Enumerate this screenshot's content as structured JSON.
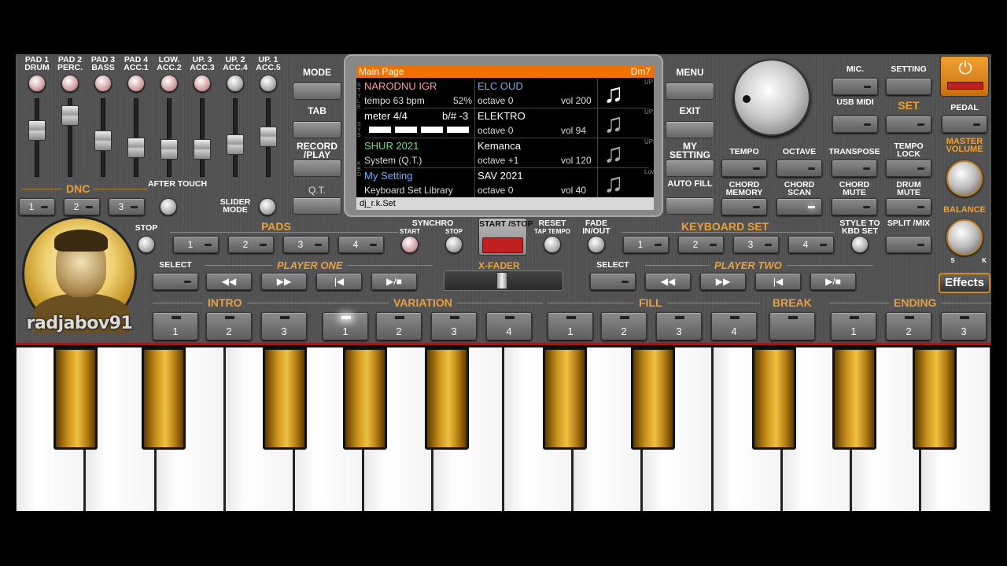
{
  "pads_top": [
    {
      "l1": "PAD 1",
      "l2": "DRUM"
    },
    {
      "l1": "PAD 2",
      "l2": "PERC."
    },
    {
      "l1": "PAD 3",
      "l2": "BASS"
    },
    {
      "l1": "PAD 4",
      "l2": "ACC.1"
    },
    {
      "l1": "LOW.",
      "l2": "ACC.2"
    },
    {
      "l1": "UP. 3",
      "l2": "ACC.3"
    },
    {
      "l1": "UP. 2",
      "l2": "ACC.4"
    },
    {
      "l1": "UP. 1",
      "l2": "ACC.5"
    }
  ],
  "mixer_levels": [
    0.62,
    0.88,
    0.45,
    0.32,
    0.3,
    0.3,
    0.38,
    0.52
  ],
  "dnc": {
    "label": "DNC",
    "buttons": [
      "1",
      "2",
      "3"
    ],
    "aftertouch": "AFTER TOUCH",
    "slider_mode": "SLIDER MODE"
  },
  "left_side": {
    "mode": "MODE",
    "tab": "TAB",
    "record": "RECORD /PLAY",
    "qt": "Q.T."
  },
  "right_side": {
    "menu": "MENU",
    "exit": "EXIT",
    "my_setting": "MY SETTING",
    "auto_fill": "AUTO FILL"
  },
  "screen": {
    "title": "Main Page",
    "chord": "Dm7",
    "rows": [
      {
        "name": "NARODNU IGR",
        "name_color": "#ff9a9a",
        "sub": "tempo 63 bpm",
        "pct": "52%",
        "voice": "ELC OUD",
        "voice_color": "#6fb0ff",
        "voice_sub": "octave  0",
        "vol": "vol 200",
        "side": "UP1"
      },
      {
        "name": "meter 4/4",
        "name_color": "#ffffff",
        "sub": "",
        "pct": "b/# -3",
        "voice": "ELEKTRO",
        "voice_color": "#ffffff",
        "voice_sub": "octave  0",
        "vol": "vol 94",
        "side": "UP2"
      },
      {
        "name": "SHUR 2021",
        "name_color": "#6fe07a",
        "sub": "System (Q.T.)",
        "pct": "",
        "voice": "Kemanca",
        "voice_color": "#ffffff",
        "voice_sub": "octave +1",
        "vol": "vol 120",
        "side": "UP3"
      },
      {
        "name": "My Setting",
        "name_color": "#6fb0ff",
        "sub": "Keyboard Set Library",
        "pct": "",
        "voice": "SAV 2021",
        "voice_color": "#ffffff",
        "voice_sub": "octave  0",
        "vol": "vol 40",
        "side": "Low"
      }
    ],
    "left_tags": [
      "STYLE",
      "SYS",
      "KBD"
    ],
    "footer": "dj_r.k.Set",
    "note_icon": "music-note-icon"
  },
  "right_top": {
    "mic": "MIC.",
    "setting": "SETTING",
    "usb_midi": "USB MIDI",
    "set": "SET",
    "pedal": "PEDAL",
    "master_volume": "MASTER VOLUME",
    "balance": "BALANCE",
    "balance_s": "S",
    "balance_k": "K",
    "tempo": "TEMPO",
    "octave": "OCTAVE",
    "transpose": "TRANSPOSE",
    "tempo_lock": "TEMPO LOCK",
    "chord_memory": "CHORD MEMORY",
    "chord_scan": "CHORD SCAN",
    "chord_mute": "CHORD MUTE",
    "drum_mute": "DRUM MUTE"
  },
  "middle": {
    "stop": "STOP",
    "pads": "PADS",
    "pad_buttons": [
      "1",
      "2",
      "3",
      "4"
    ],
    "synchro": "SYNCHRO",
    "synchro_start": "START",
    "synchro_stop": "STOP",
    "start_stop": "START /STOP",
    "reset": "RESET",
    "tap_tempo": "TAP TEMPO",
    "fade": "FADE IN/OUT",
    "keyboard_set": "KEYBOARD SET",
    "kbd_buttons": [
      "1",
      "2",
      "3",
      "4"
    ],
    "style_to_kbd": "STYLE TO KBD SET",
    "split_mix": "SPLIT /MIX",
    "select": "SELECT",
    "player_one": "PLAYER ONE",
    "player_two": "PLAYER TWO",
    "xfader": "X-FADER",
    "player_icons": [
      "◀◀",
      "▶▶",
      "|◀",
      "▶/■"
    ]
  },
  "effects": "Effects",
  "bottom": {
    "intro": "INTRO",
    "intro_buttons": [
      "1",
      "2",
      "3"
    ],
    "variation": "VARIATION",
    "variation_buttons": [
      "1",
      "2",
      "3",
      "4"
    ],
    "fill": "FILL",
    "fill_buttons": [
      "1",
      "2",
      "3",
      "4"
    ],
    "break": "BREAK",
    "ending": "ENDING",
    "ending_buttons": [
      "1",
      "2",
      "3"
    ]
  },
  "avatar_name": "radjabov91",
  "colors": {
    "accent": "#e8a040",
    "panel": "#545454",
    "screen_title": "#f07000",
    "red_led": "#c02020",
    "gold_key": "#f0c040"
  }
}
